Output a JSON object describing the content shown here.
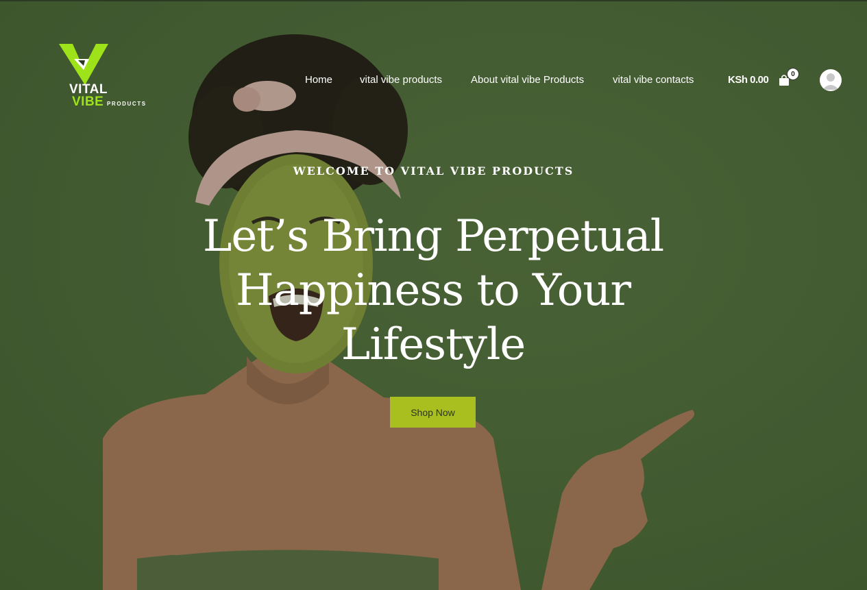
{
  "brand": {
    "word1": "VITAL",
    "word2": "VIBE",
    "word3": "PRODUCTS",
    "accent_color": "#9ee21a"
  },
  "nav": {
    "items": [
      {
        "label": "Home"
      },
      {
        "label": "vital vibe products"
      },
      {
        "label": "About vital vibe Products"
      },
      {
        "label": "vital vibe contacts"
      }
    ]
  },
  "cart": {
    "total": "KSh 0.00",
    "count": "0",
    "icon": "shopping-bag-icon"
  },
  "account": {
    "icon": "user-avatar-icon"
  },
  "hero": {
    "eyebrow": "WELCOME TO VITAL VIBE PRODUCTS",
    "headline": "Let’s Bring Perpetual Happiness to Your Lifestyle",
    "cta_label": "Shop Now",
    "cta_color": "#a8bf1f",
    "background_color": "#4f6a3a"
  }
}
